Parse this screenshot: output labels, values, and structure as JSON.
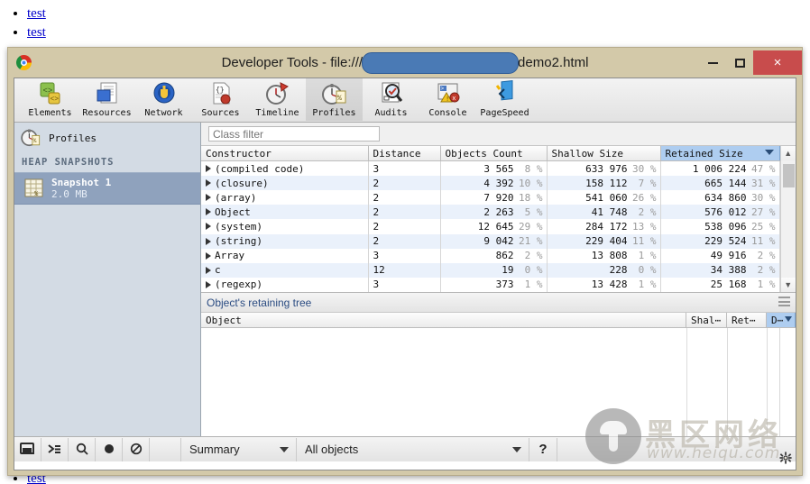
{
  "background_page": {
    "links": [
      "test",
      "test",
      "test",
      "test"
    ]
  },
  "window": {
    "title_prefix": "Developer Tools - file:///",
    "title_suffix": "demo2.html",
    "minimize_label": "–",
    "maximize_label": "□",
    "close_label": "×"
  },
  "toolbar": {
    "tabs": [
      {
        "label": "Elements",
        "icon": "elements-icon",
        "active": false
      },
      {
        "label": "Resources",
        "icon": "resources-icon",
        "active": false
      },
      {
        "label": "Network",
        "icon": "network-icon",
        "active": false
      },
      {
        "label": "Sources",
        "icon": "sources-icon",
        "active": false
      },
      {
        "label": "Timeline",
        "icon": "timeline-icon",
        "active": false
      },
      {
        "label": "Profiles",
        "icon": "profiles-icon",
        "active": true
      },
      {
        "label": "Audits",
        "icon": "audits-icon",
        "active": false
      },
      {
        "label": "Console",
        "icon": "console-icon",
        "active": false
      },
      {
        "label": "PageSpeed",
        "icon": "pagespeed-icon",
        "active": false
      }
    ]
  },
  "sidebar": {
    "header": "Profiles",
    "section_title": "HEAP SNAPSHOTS",
    "items": [
      {
        "name": "Snapshot 1",
        "size": "2.0 MB",
        "selected": true
      }
    ]
  },
  "filter": {
    "placeholder": "Class filter",
    "value": ""
  },
  "grid": {
    "columns": [
      {
        "key": "constructor",
        "label": "Constructor",
        "sorted": false
      },
      {
        "key": "distance",
        "label": "Distance",
        "sorted": false
      },
      {
        "key": "objects_count",
        "label": "Objects Count",
        "sorted": false
      },
      {
        "key": "shallow_size",
        "label": "Shallow Size",
        "sorted": false
      },
      {
        "key": "retained_size",
        "label": "Retained Size",
        "sorted": true
      }
    ],
    "rows": [
      {
        "constructor": "(compiled code)",
        "distance": "3",
        "objects_count": "3 565",
        "objects_pct": "8 %",
        "shallow_size": "633 976",
        "shallow_pct": "30 %",
        "retained_size": "1 006 224",
        "retained_pct": "47 %"
      },
      {
        "constructor": "(closure)",
        "distance": "2",
        "objects_count": "4 392",
        "objects_pct": "10 %",
        "shallow_size": "158 112",
        "shallow_pct": "7 %",
        "retained_size": "665 144",
        "retained_pct": "31 %"
      },
      {
        "constructor": "(array)",
        "distance": "2",
        "objects_count": "7 920",
        "objects_pct": "18 %",
        "shallow_size": "541 060",
        "shallow_pct": "26 %",
        "retained_size": "634 860",
        "retained_pct": "30 %"
      },
      {
        "constructor": "Object",
        "distance": "2",
        "objects_count": "2 263",
        "objects_pct": "5 %",
        "shallow_size": "41 748",
        "shallow_pct": "2 %",
        "retained_size": "576 012",
        "retained_pct": "27 %"
      },
      {
        "constructor": "(system)",
        "distance": "2",
        "objects_count": "12 645",
        "objects_pct": "29 %",
        "shallow_size": "284 172",
        "shallow_pct": "13 %",
        "retained_size": "538 096",
        "retained_pct": "25 %"
      },
      {
        "constructor": "(string)",
        "distance": "2",
        "objects_count": "9 042",
        "objects_pct": "21 %",
        "shallow_size": "229 404",
        "shallow_pct": "11 %",
        "retained_size": "229 524",
        "retained_pct": "11 %"
      },
      {
        "constructor": "Array",
        "distance": "3",
        "objects_count": "862",
        "objects_pct": "2 %",
        "shallow_size": "13 808",
        "shallow_pct": "1 %",
        "retained_size": "49 916",
        "retained_pct": "2 %"
      },
      {
        "constructor": "c",
        "distance": "12",
        "objects_count": "19",
        "objects_pct": "0 %",
        "shallow_size": "228",
        "shallow_pct": "0 %",
        "retained_size": "34 388",
        "retained_pct": "2 %"
      },
      {
        "constructor": "(regexp)",
        "distance": "3",
        "objects_count": "373",
        "objects_pct": "1 %",
        "shallow_size": "13 428",
        "shallow_pct": "1 %",
        "retained_size": "25 168",
        "retained_pct": "1 %"
      }
    ]
  },
  "retaining_tree": {
    "title": "Object's retaining tree",
    "columns": [
      {
        "label": "Object",
        "sorted": false
      },
      {
        "label": "Shal⋯",
        "sorted": false
      },
      {
        "label": "Ret⋯",
        "sorted": false
      },
      {
        "label": "D⋯",
        "sorted": true
      }
    ],
    "rows": []
  },
  "statusbar": {
    "buttons": [
      {
        "name": "dock-panel-icon",
        "label": ""
      },
      {
        "name": "console-drawer-icon",
        "label": ""
      },
      {
        "name": "search-icon",
        "label": ""
      },
      {
        "name": "record-icon",
        "label": ""
      },
      {
        "name": "clear-icon",
        "label": ""
      }
    ],
    "view_select": "Summary",
    "scope_select": "All objects",
    "help_label": "?"
  },
  "watermark": {
    "cn_text": "黑区网络",
    "url_text": "www.heiqu.com"
  },
  "colors": {
    "window_frame": "#d3c9a9",
    "close_button": "#c84c4c",
    "selected_row": "#8fa2bd",
    "sorted_header": "#aecdf0",
    "redaction": "#4a7ab5",
    "panel_title": "#2b4c82"
  }
}
